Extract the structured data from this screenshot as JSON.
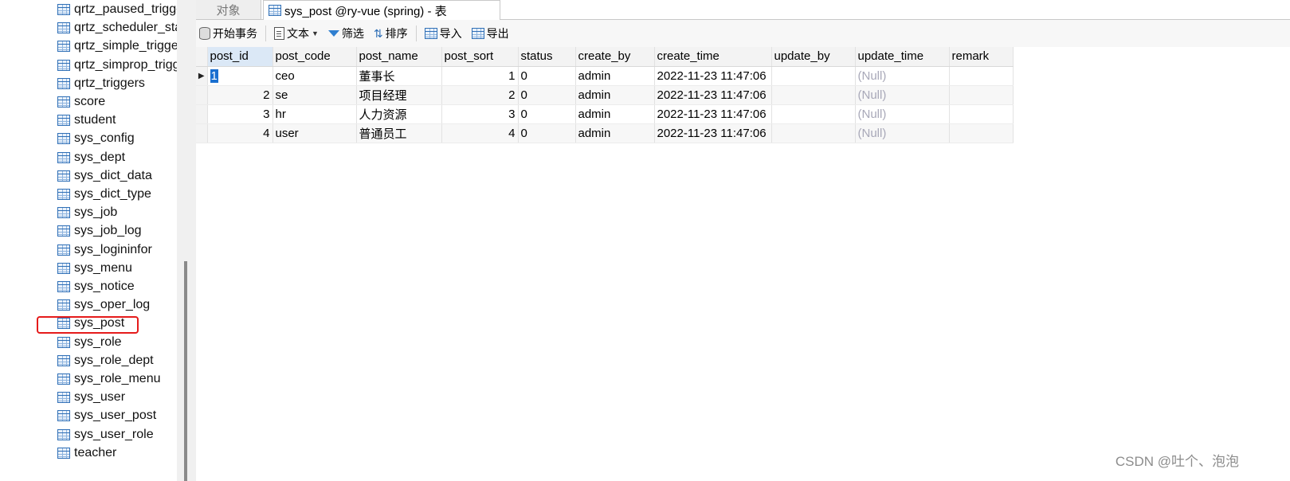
{
  "sidebar": {
    "items": [
      "qrtz_paused_trigge",
      "qrtz_scheduler_sta",
      "qrtz_simple_trigge",
      "qrtz_simprop_trigg",
      "qrtz_triggers",
      "score",
      "student",
      "sys_config",
      "sys_dept",
      "sys_dict_data",
      "sys_dict_type",
      "sys_job",
      "sys_job_log",
      "sys_logininfor",
      "sys_menu",
      "sys_notice",
      "sys_oper_log",
      "sys_post",
      "sys_role",
      "sys_role_dept",
      "sys_role_menu",
      "sys_user",
      "sys_user_post",
      "sys_user_role",
      "teacher"
    ],
    "highlighted_item": "sys_post",
    "highlight_color": "#e51b1b"
  },
  "tabs": {
    "objects": "对象",
    "active": "sys_post @ry-vue (spring) - 表"
  },
  "toolbar": {
    "begin_transaction": "开始事务",
    "text": "文本",
    "filter": "筛选",
    "sort": "排序",
    "import": "导入",
    "export": "导出"
  },
  "grid": {
    "columns": [
      "post_id",
      "post_code",
      "post_name",
      "post_sort",
      "status",
      "create_by",
      "create_time",
      "update_by",
      "update_time",
      "remark"
    ],
    "rows": [
      {
        "post_id": "1",
        "post_code": "ceo",
        "post_name": "董事长",
        "post_sort": "1",
        "status": "0",
        "create_by": "admin",
        "create_time": "2022-11-23 11:47:06",
        "update_by": "",
        "update_time": "(Null)",
        "remark": ""
      },
      {
        "post_id": "2",
        "post_code": "se",
        "post_name": "项目经理",
        "post_sort": "2",
        "status": "0",
        "create_by": "admin",
        "create_time": "2022-11-23 11:47:06",
        "update_by": "",
        "update_time": "(Null)",
        "remark": ""
      },
      {
        "post_id": "3",
        "post_code": "hr",
        "post_name": "人力资源",
        "post_sort": "3",
        "status": "0",
        "create_by": "admin",
        "create_time": "2022-11-23 11:47:06",
        "update_by": "",
        "update_time": "(Null)",
        "remark": ""
      },
      {
        "post_id": "4",
        "post_code": "user",
        "post_name": "普通员工",
        "post_sort": "4",
        "status": "0",
        "create_by": "admin",
        "create_time": "2022-11-23 11:47:06",
        "update_by": "",
        "update_time": "(Null)",
        "remark": ""
      }
    ],
    "current_row_marker": "▶",
    "selection_color": "#1a6fd0"
  },
  "watermark": "CSDN @吐个、泡泡"
}
